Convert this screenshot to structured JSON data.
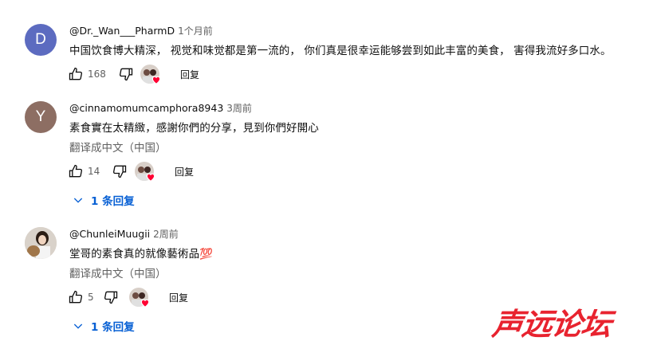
{
  "comments": [
    {
      "avatar_letter": "D",
      "avatar_color": "#5c6bc0",
      "author": "@Dr._Wan___PharmD",
      "time": "1个月前",
      "text": "中国饮食博大精深， 视觉和味觉都是第一流的， 你们真是很幸运能够尝到如此丰富的美食， 害得我流好多口水。",
      "likes": "168",
      "reply_label": "回复"
    },
    {
      "avatar_letter": "Y",
      "avatar_color": "#8d6e63",
      "author": "@cinnamomumcamphora8943",
      "time": "3周前",
      "text": "素食實在太精緻，感謝你們的分享，見到你們好開心",
      "translate": "翻译成中文（中国）",
      "likes": "14",
      "reply_label": "回复",
      "replies_label": "1 条回复"
    },
    {
      "author": "@ChunleiMuugii",
      "time": "2周前",
      "text": "堂哥的素食真的就像藝術品💯",
      "translate": "翻译成中文（中国）",
      "likes": "5",
      "reply_label": "回复",
      "replies_label": "1 条回复"
    }
  ],
  "watermark": "声远论坛",
  "colors": {
    "link": "#065fd4",
    "heart": "#ff0033",
    "watermark": "#e8232f"
  }
}
